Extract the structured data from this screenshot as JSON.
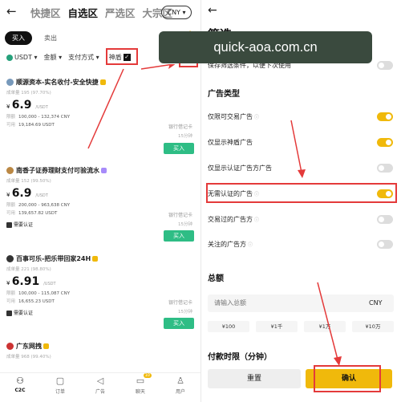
{
  "left": {
    "tabs": [
      "快捷区",
      "自选区",
      "严选区",
      "大宗区"
    ],
    "currency": "CNY ▾",
    "mode": {
      "buy": "买入",
      "sell": "卖出"
    },
    "filters": {
      "coin": "USDT",
      "amount": "金额",
      "payment": "支付方式",
      "shendun": "神盾"
    },
    "listings": [
      {
        "name": "顺源资本-实名收付-安全快捷",
        "stats": "成单量 195 (97.70%)",
        "price": "6.9",
        "unit": "/USDT",
        "limit_label": "限额",
        "limit": "100,000 - 132,374 CNY",
        "avail_label": "可用",
        "avail": "19,184.69 USDT",
        "pay": "银行借记卡",
        "time": "15分钟",
        "buy": "买入",
        "verify": ""
      },
      {
        "name": "南香子证券理财支付可验流水",
        "stats": "成单量 152 (99.50%)",
        "price": "6.9",
        "unit": "/USDT",
        "limit_label": "限额",
        "limit": "200,000 - 963,638 CNY",
        "avail_label": "可用",
        "avail": "139,657.82 USDT",
        "pay": "银行借记卡",
        "time": "15分钟",
        "buy": "买入",
        "verify": "需要认证"
      },
      {
        "name": "百事可乐-把乐带回家24H",
        "stats": "成单量 221 (98.80%)",
        "price": "6.91",
        "unit": "/USDT",
        "limit_label": "限额",
        "limit": "100,000 - 115,087 CNY",
        "avail_label": "可用",
        "avail": "16,655.23 USDT",
        "pay": "银行借记卡",
        "time": "15分钟",
        "buy": "买入",
        "verify": "需要认证"
      },
      {
        "name": "广东网拽",
        "stats": "成单量 968 (99.40%)",
        "price": "",
        "unit": "",
        "limit_label": "",
        "limit": "",
        "avail_label": "",
        "avail": "",
        "pay": "",
        "time": "",
        "buy": "",
        "verify": ""
      }
    ],
    "nav": [
      {
        "label": "C2C",
        "icon": "people-icon"
      },
      {
        "label": "订单",
        "icon": "order-icon"
      },
      {
        "label": "广告",
        "icon": "megaphone-icon"
      },
      {
        "label": "聊天",
        "icon": "chat-icon",
        "badge": "10"
      },
      {
        "label": "用户",
        "icon": "user-icon"
      }
    ]
  },
  "right": {
    "title": "筛选",
    "watermark": "quick-aoa.com.cn",
    "save_filter": "保存筛选条件，以便下次使用",
    "section_ad_type": "广告类型",
    "toggles": [
      {
        "label": "仅限可交易广告",
        "on": true
      },
      {
        "label": "仅显示神盾广告",
        "on": true
      },
      {
        "label": "仅显示认证广告方广告",
        "on": false
      },
      {
        "label": "无需认证的广告",
        "on": true
      },
      {
        "label": "交易过的广告方",
        "on": false
      },
      {
        "label": "关注的广告方",
        "on": false
      }
    ],
    "section_amount": "总额",
    "amount_placeholder": "请输入总额",
    "amount_currency": "CNY",
    "quick_amounts": [
      "¥100",
      "¥1千",
      "¥1万",
      "¥10万"
    ],
    "section_pay_time": "付款时限（分钟）",
    "reset": "重置",
    "confirm": "确认"
  },
  "colors": {
    "accent": "#f0b90b",
    "buy": "#2ebd85",
    "highlight": "#e43a3a",
    "watermark_bg": "#3a4a3e"
  }
}
